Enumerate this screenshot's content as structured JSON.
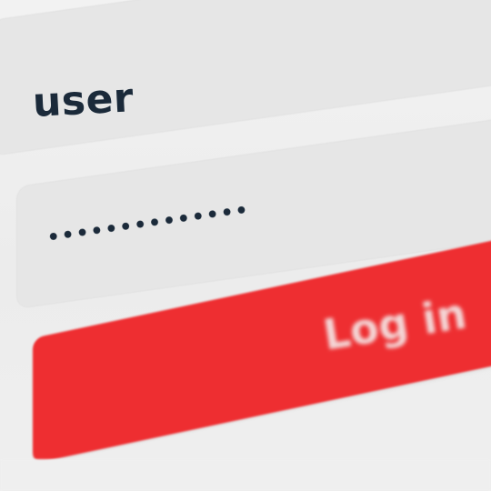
{
  "login_form": {
    "username_value": "user",
    "password_masked": "••••••••••••••",
    "login_button_label": "Log in"
  },
  "colors": {
    "field_background": "#e6e6e6",
    "button_red": "#ee2e31",
    "text_dark": "#1b2a3a"
  }
}
